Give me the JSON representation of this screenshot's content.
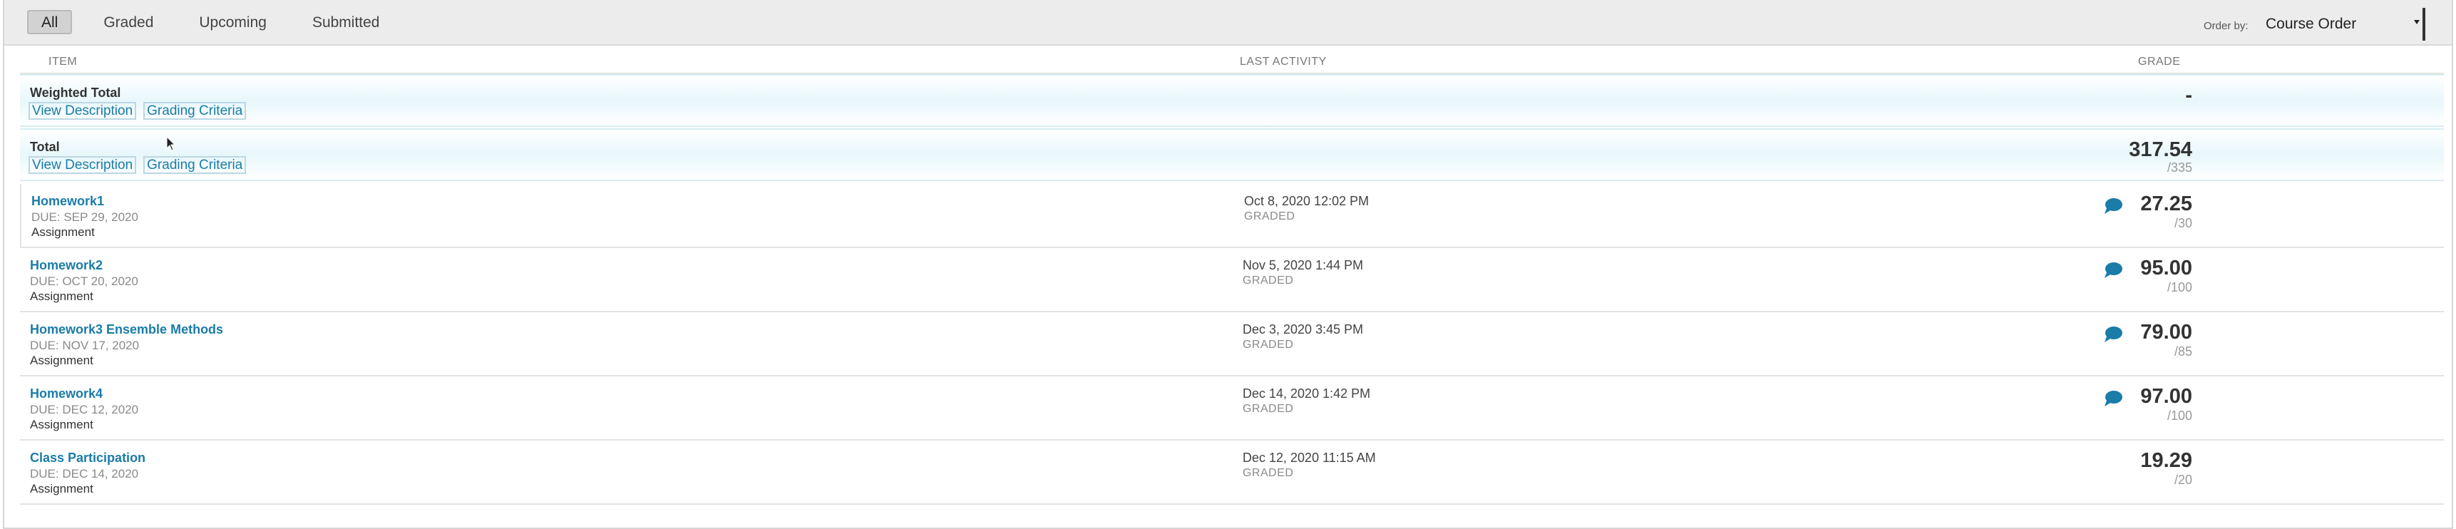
{
  "filters": [
    "All",
    "Graded",
    "Upcoming",
    "Submitted"
  ],
  "order": {
    "label": "Order by:",
    "value": "Course Order"
  },
  "columns": {
    "item": "ITEM",
    "last_activity": "LAST ACTIVITY",
    "grade": "GRADE"
  },
  "summary": [
    {
      "title": "Weighted Total",
      "view": "View Description",
      "criteria": "Grading Criteria",
      "score": "-",
      "out_of": ""
    },
    {
      "title": "Total",
      "view": "View Description",
      "criteria": "Grading Criteria",
      "score": "317.54",
      "out_of": "/335"
    }
  ],
  "items": [
    {
      "name": "Homework1",
      "due": "DUE: SEP 29, 2020",
      "type": "Assignment",
      "activity": "Oct 8, 2020 12:02 PM",
      "status": "GRADED",
      "score": "27.25",
      "out_of": "/30",
      "comment": true
    },
    {
      "name": "Homework2",
      "due": "DUE: OCT 20, 2020",
      "type": "Assignment",
      "activity": "Nov 5, 2020 1:44 PM",
      "status": "GRADED",
      "score": "95.00",
      "out_of": "/100",
      "comment": true
    },
    {
      "name": "Homework3 Ensemble Methods",
      "due": "DUE: NOV 17, 2020",
      "type": "Assignment",
      "activity": "Dec 3, 2020 3:45 PM",
      "status": "GRADED",
      "score": "79.00",
      "out_of": "/85",
      "comment": true
    },
    {
      "name": "Homework4",
      "due": "DUE: DEC 12, 2020",
      "type": "Assignment",
      "activity": "Dec 14, 2020 1:42 PM",
      "status": "GRADED",
      "score": "97.00",
      "out_of": "/100",
      "comment": true
    },
    {
      "name": "Class Participation",
      "due": "DUE: DEC 14, 2020",
      "type": "Assignment",
      "activity": "Dec 12, 2020 11:15 AM",
      "status": "GRADED",
      "score": "19.29",
      "out_of": "/20",
      "comment": false
    }
  ],
  "colors": {
    "link": "#1a7ca8",
    "comment_icon": "#1a7ca8",
    "summary_tint": "#e8f7fb"
  }
}
